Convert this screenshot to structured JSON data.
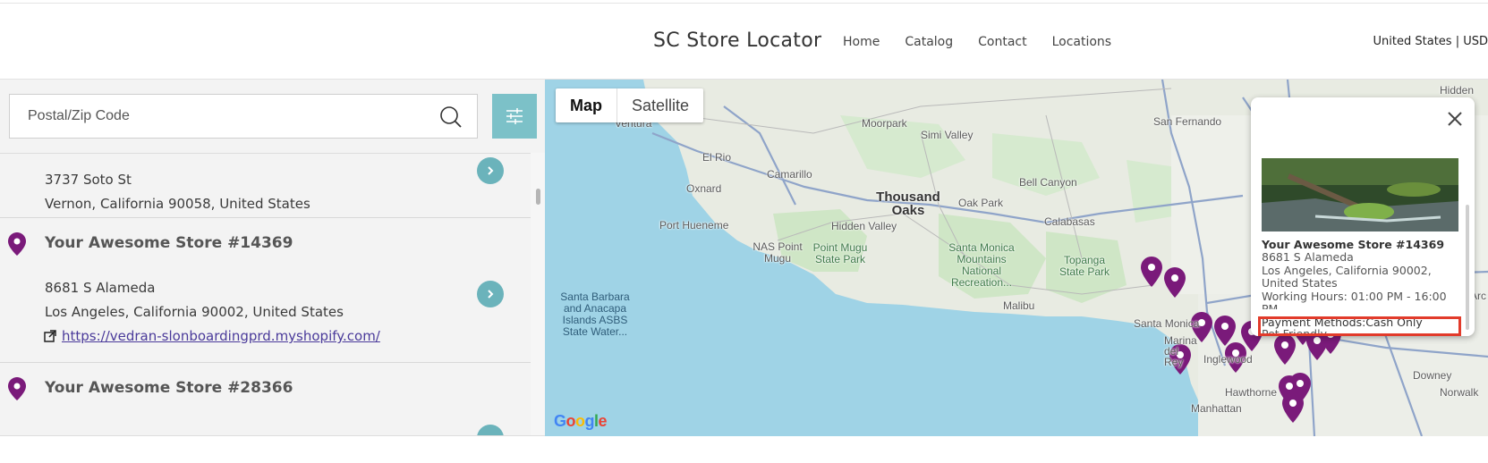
{
  "header": {
    "title": "SC Store Locator",
    "nav": [
      "Home",
      "Catalog",
      "Contact",
      "Locations"
    ],
    "locale": "United States | USD"
  },
  "search": {
    "placeholder": "Postal/Zip Code"
  },
  "stores": [
    {
      "address_line1": "3737 Soto St",
      "address_line2": "Vernon, California 90058, United States"
    },
    {
      "name": "Your Awesome Store #14369",
      "address_line1": "8681 S Alameda",
      "address_line2": "Los Angeles, California 90002, United States",
      "url": "https://vedran-slonboardingprd.myshopify.com/"
    },
    {
      "name": "Your Awesome Store #28366"
    }
  ],
  "map": {
    "type_buttons": [
      "Map",
      "Satellite"
    ],
    "attribution": "Google",
    "labels": {
      "ventura": "Ventura",
      "moorpark": "Moorpark",
      "simi_valley": "Simi Valley",
      "el_rio": "El Rio",
      "camarillo": "Camarillo",
      "oxnard": "Oxnard",
      "thousand_oaks": "Thousand Oaks",
      "oak_park": "Oak Park",
      "bell_canyon": "Bell Canyon",
      "hidden_valley": "Hidden Valley",
      "calabasas": "Calabasas",
      "port_hueneme": "Port Hueneme",
      "nas_point_mugu": "NAS Point Mugu",
      "point_mugu_sp": "Point Mugu State Park",
      "santa_monica_mtns": "Santa Monica Mountains National Recreation...",
      "topanga_sp": "Topanga State Park",
      "malibu": "Malibu",
      "santa_monica": "Santa Monica",
      "marina_del_rey": "Marina del Rey",
      "inglewood": "Inglewood",
      "hawthorne": "Hawthorne",
      "manhattan": "Manhattan",
      "downey": "Downey",
      "norwalk": "Norwalk",
      "hidden": "Hidden",
      "san_fernando": "San Fernando",
      "arc": "Arc",
      "santa_barbara_islands": "Santa Barbara and Anacapa Islands ASBS State Water..."
    },
    "popup": {
      "name": "Your Awesome Store #14369",
      "address_line1": "8681 S Alameda",
      "address_line2": "Los Angeles, California 90002,",
      "address_line3": "United States",
      "hours": "Working Hours: 01:00 PM - 16:00",
      "hours_cont": "PM",
      "payment": "Payment Methods:Cash Only",
      "pet": "Pet Friendly"
    }
  },
  "colors": {
    "accent": "#7cc1c8",
    "pin": "#7a1a7a",
    "highlight": "#e23b2b",
    "water": "#9fd3e6"
  }
}
